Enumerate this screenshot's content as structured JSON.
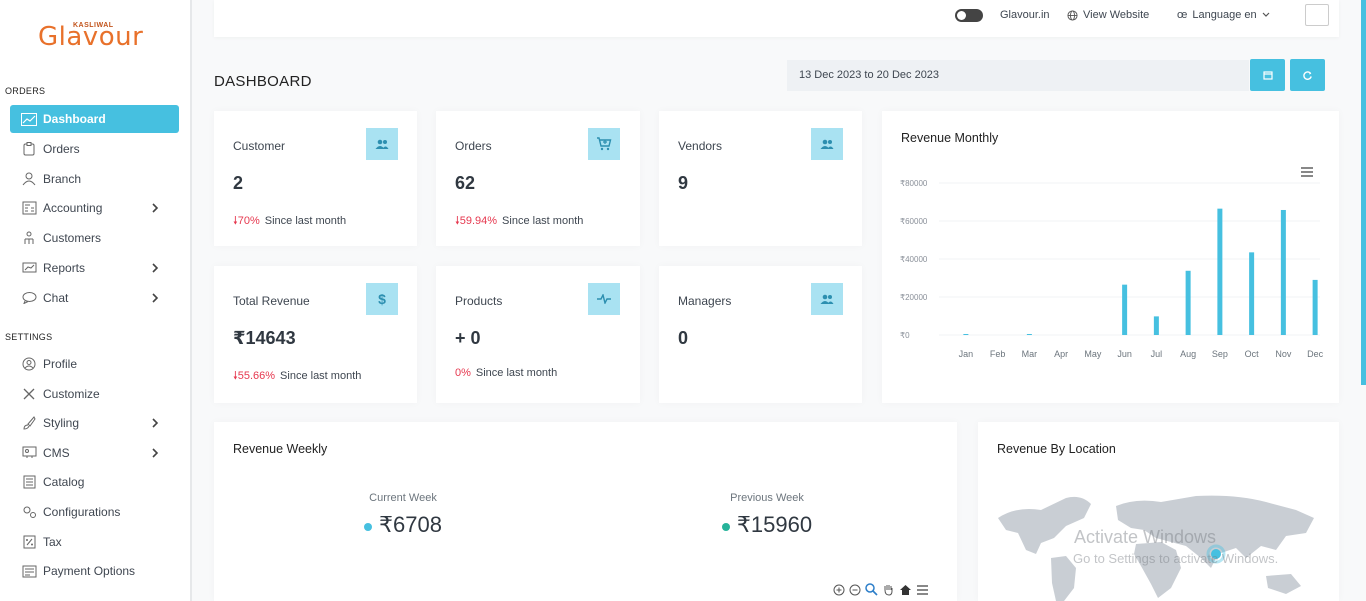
{
  "brand": {
    "small": "KASLIWAL",
    "big": "Glavour"
  },
  "sidebar": {
    "orders_title": "ORDERS",
    "settings_title": "SETTINGS",
    "orders_items": [
      {
        "label": "Dashboard",
        "icon": "dashboard-icon",
        "active": true
      },
      {
        "label": "Orders",
        "icon": "clipboard-icon"
      },
      {
        "label": "Branch",
        "icon": "user-tie-icon"
      },
      {
        "label": "Accounting",
        "icon": "calculator-icon",
        "chevron": true
      },
      {
        "label": "Customers",
        "icon": "user-group-icon"
      },
      {
        "label": "Reports",
        "icon": "chart-icon",
        "chevron": true
      },
      {
        "label": "Chat",
        "icon": "chat-icon",
        "chevron": true
      }
    ],
    "settings_items": [
      {
        "label": "Profile",
        "icon": "profile-icon"
      },
      {
        "label": "Customize",
        "icon": "tools-icon"
      },
      {
        "label": "Styling",
        "icon": "brush-icon",
        "chevron": true
      },
      {
        "label": "CMS",
        "icon": "cms-icon",
        "chevron": true
      },
      {
        "label": "Catalog",
        "icon": "catalog-icon"
      },
      {
        "label": "Configurations",
        "icon": "gears-icon"
      },
      {
        "label": "Tax",
        "icon": "tax-icon"
      },
      {
        "label": "Payment Options",
        "icon": "payment-icon"
      }
    ]
  },
  "header": {
    "site_name": "Glavour.in",
    "view_website": "View Website",
    "language": "Language en"
  },
  "dashboard": {
    "title": "DASHBOARD",
    "date_range": "13 Dec 2023 to 20 Dec 2023"
  },
  "stats": {
    "customer": {
      "label": "Customer",
      "value": "2",
      "pct": "70%",
      "since": "Since last month"
    },
    "orders": {
      "label": "Orders",
      "value": "62",
      "pct": "59.94%",
      "since": "Since last month"
    },
    "vendors": {
      "label": "Vendors",
      "value": "9"
    },
    "revenue": {
      "label": "Total Revenue",
      "value": "₹14643",
      "pct": "55.66%",
      "since": "Since last month"
    },
    "products": {
      "label": "Products",
      "value": "+ 0",
      "pct": "0%",
      "since": "Since last month"
    },
    "managers": {
      "label": "Managers",
      "value": "0"
    }
  },
  "revenue_monthly": {
    "title": "Revenue Monthly"
  },
  "chart_data": {
    "type": "bar",
    "title": "Revenue Monthly",
    "categories": [
      "Jan",
      "Feb",
      "Mar",
      "Apr",
      "May",
      "Jun",
      "Jul",
      "Aug",
      "Sep",
      "Oct",
      "Nov",
      "Dec"
    ],
    "values": [
      150,
      0,
      200,
      0,
      0,
      26500,
      9800,
      33800,
      66500,
      43500,
      65800,
      29000
    ],
    "yticks": [
      "₹80000",
      "₹60000",
      "₹40000",
      "₹20000",
      "₹0"
    ],
    "ylim": [
      0,
      80000
    ],
    "color": "#46c0e0"
  },
  "revenue_weekly": {
    "title": "Revenue Weekly",
    "current_label": "Current Week",
    "current_value": "₹6708",
    "previous_label": "Previous Week",
    "previous_value": "₹15960",
    "current_color": "#46c0e0",
    "previous_color": "#26b39a"
  },
  "revenue_location": {
    "title": "Revenue By Location"
  },
  "watermark": {
    "line1": "Activate Windows",
    "line2": "Go to Settings to activate Windows."
  }
}
